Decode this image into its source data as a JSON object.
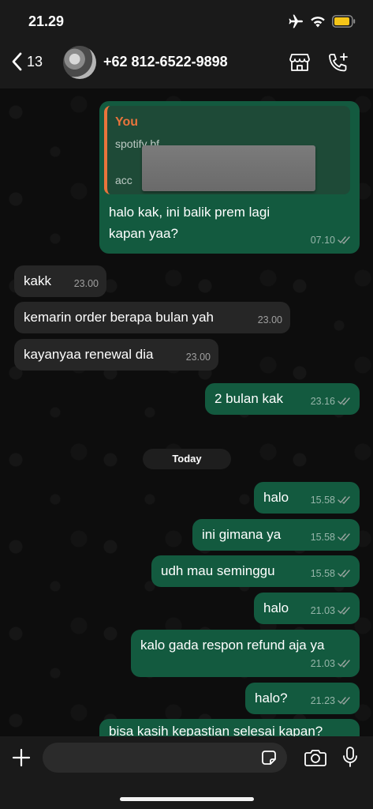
{
  "status": {
    "time": "21.29"
  },
  "header": {
    "back_count": "13",
    "contact_name": "+62 812-6522-9898"
  },
  "reply_quote": {
    "author": "You",
    "line1": "spotify bf",
    "line2": "acc"
  },
  "messages": [
    {
      "text": "halo kak, ini balik prem lagi",
      "text2": "kapan yaa?",
      "time": "07.10"
    },
    {
      "text": "kakk",
      "time": "23.00"
    },
    {
      "text": "kemarin order berapa bulan yah",
      "time": "23.00"
    },
    {
      "text": "kayanyaa renewal dia",
      "time": "23.00"
    },
    {
      "text": "2 bulan kak",
      "time": "23.16"
    },
    {
      "text": "halo",
      "time": "15.58"
    },
    {
      "text": "ini gimana ya",
      "time": "15.58"
    },
    {
      "text": "udh mau seminggu",
      "time": "15.58"
    },
    {
      "text": "halo",
      "time": "21.03"
    },
    {
      "text": "kalo gada respon refund aja ya",
      "time": "21.03"
    },
    {
      "text": "halo?",
      "time": "21.23"
    },
    {
      "text": "bisa kasih kepastian selesai kapan?"
    }
  ],
  "date_divider": "Today",
  "composer": {
    "placeholder": ""
  },
  "colors": {
    "outgoing": "#135a3f",
    "incoming": "#262626",
    "quote_accent": "#e8743c",
    "read_ticks": "#9aa5a0"
  }
}
